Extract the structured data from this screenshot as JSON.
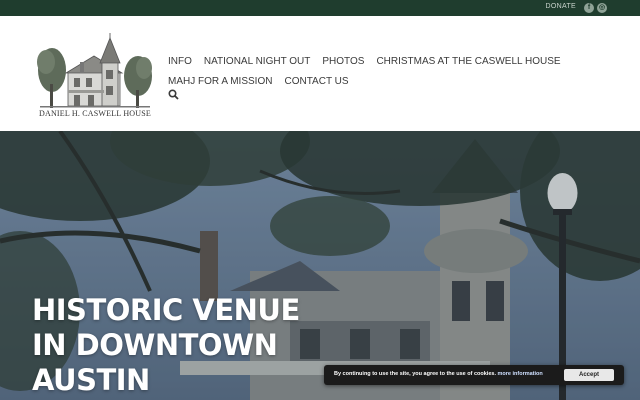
{
  "topbar": {
    "donate": "DONATE",
    "social": [
      {
        "icon": "facebook-icon",
        "glyph": "f"
      },
      {
        "icon": "instagram-icon",
        "glyph": "◎"
      }
    ]
  },
  "logo": {
    "caption": "DANIEL H. CASWELL HOUSE"
  },
  "nav": {
    "row1": [
      "INFO",
      "NATIONAL NIGHT OUT",
      "PHOTOS",
      "CHRISTMAS AT THE CASWELL HOUSE"
    ],
    "row2": [
      "MAHJ FOR A MISSION",
      "CONTACT US"
    ],
    "search_icon": "search-icon"
  },
  "hero": {
    "title_lines": [
      "HISTORIC VENUE",
      "IN DOWNTOWN",
      "AUSTIN"
    ]
  },
  "cookie": {
    "message": "By continuing to use the site, you agree to the use of cookies.",
    "more": "more information",
    "accept": "Accept"
  },
  "colors": {
    "topbar": "#1f3d2e",
    "nav_text": "#3a3a3a",
    "hero_text": "#ffffff"
  }
}
